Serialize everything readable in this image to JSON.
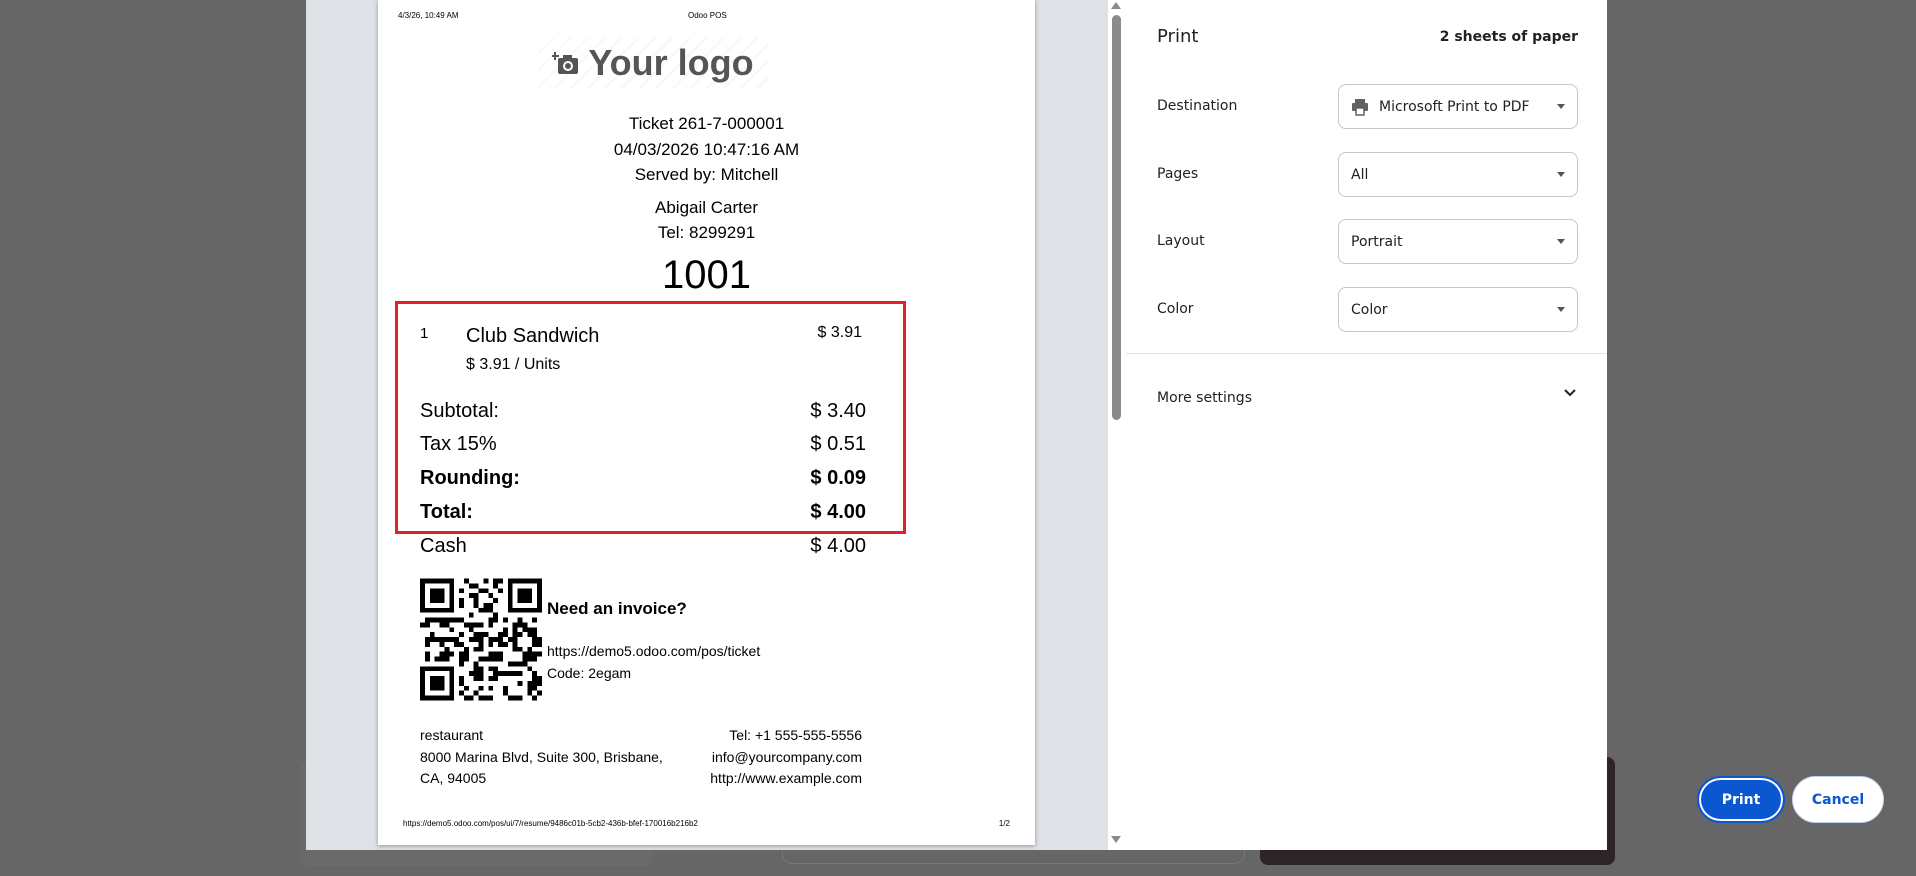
{
  "receipt": {
    "header_datetime": "4/3/26, 10:49 AM",
    "header_title": "Odoo POS",
    "logo_text": "Your logo",
    "ticket": "Ticket 261-7-000001",
    "datetime": "04/03/2026 10:47:16 AM",
    "served_by": "Served by: Mitchell",
    "customer_name": "Abigail Carter",
    "customer_tel": "Tel: 8299291",
    "order_number": "1001",
    "line": {
      "qty": "1",
      "product": "Club Sandwich",
      "price": "$ 3.91",
      "unit_price": "$ 3.91 / Units"
    },
    "subtotal_label": "Subtotal:",
    "subtotal": "$ 3.40",
    "tax_label": "Tax 15%",
    "tax": "$ 0.51",
    "rounding_label": "Rounding:",
    "rounding": "$ 0.09",
    "total_label": "Total:",
    "total": "$ 4.00",
    "cash_label": "Cash",
    "cash": "$ 4.00",
    "invoice_heading": "Need an invoice?",
    "invoice_url": "https://demo5.odoo.com/pos/ticket",
    "invoice_code": "Code: 2egam",
    "company_name": "restaurant",
    "address_1": "8000 Marina Blvd, Suite 300, Brisbane,",
    "address_2": "CA, 94005",
    "company_tel": "Tel: +1 555-555-5556",
    "company_email": "info@yourcompany.com",
    "company_web": "http://www.example.com",
    "footer_url": "https://demo5.odoo.com/pos/ui/7/resume/9486c01b-5cb2-436b-bfef-170016b216b2",
    "page_indicator": "1/2"
  },
  "settings": {
    "title": "Print",
    "sheets": "2 sheets of paper",
    "destination_label": "Destination",
    "destination_value": "Microsoft Print to PDF",
    "pages_label": "Pages",
    "pages_value": "All",
    "layout_label": "Layout",
    "layout_value": "Portrait",
    "color_label": "Color",
    "color_value": "Color",
    "more_settings": "More settings",
    "print_button": "Print",
    "cancel_button": "Cancel"
  },
  "colors": {
    "accent": "#0b57d0",
    "highlight_box": "#e0202b"
  }
}
